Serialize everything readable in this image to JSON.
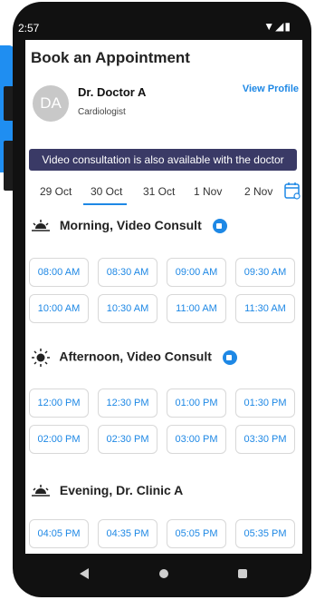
{
  "status_bar": {
    "time": "2:57",
    "icons": "▼◢▮"
  },
  "header": {
    "title": "Book an Appointment"
  },
  "doctor": {
    "initials": "DA",
    "name": "Dr. Doctor A",
    "specialty": "Cardiologist",
    "view_profile": "View Profile"
  },
  "banner": {
    "text": "Video consultation is also available with the doctor"
  },
  "dates": [
    "29 Oct",
    "30 Oct",
    "31 Oct",
    "1 Nov",
    "2 Nov"
  ],
  "selected_date": "30 Oct",
  "sections": {
    "morning": {
      "title": "Morning, Video Consult",
      "slots": [
        "08:00 AM",
        "08:30 AM",
        "09:00 AM",
        "09:30 AM",
        "10:00 AM",
        "10:30 AM",
        "11:00 AM",
        "11:30 AM"
      ]
    },
    "afternoon": {
      "title": "Afternoon, Video Consult",
      "slots": [
        "12:00 PM",
        "12:30 PM",
        "01:00 PM",
        "01:30 PM",
        "02:00 PM",
        "02:30 PM",
        "03:00 PM",
        "03:30 PM"
      ]
    },
    "evening": {
      "title": "Evening, Dr. Clinic A",
      "slots": [
        "04:05 PM",
        "04:35 PM",
        "05:05 PM",
        "05:35 PM"
      ]
    }
  },
  "colors": {
    "accent": "#1e88e5",
    "banner_bg": "#3a3a66",
    "phone_frame": "#111111",
    "side_tab": "#1f8ef1"
  },
  "icons": {
    "calendar": "calendar-icon",
    "morning": "sunrise-icon",
    "afternoon": "sun-icon",
    "evening": "sunset-icon",
    "video": "video-icon"
  }
}
